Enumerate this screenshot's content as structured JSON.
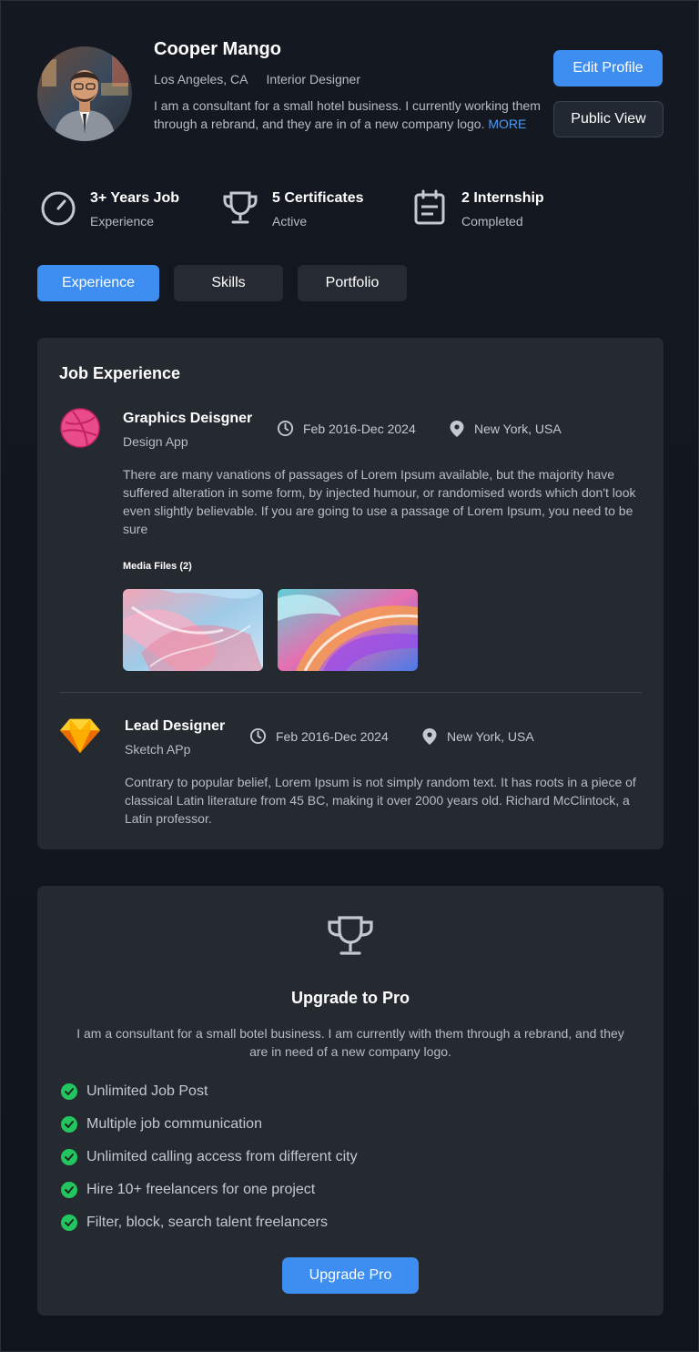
{
  "profile": {
    "name": "Cooper Mango",
    "location": "Los Angeles, CA",
    "role": "Interior Designer",
    "bio": "I am a consultant for a small hotel business. I currently working them through a rebrand, and they are in of a new company logo.",
    "more_label": "MORE",
    "edit_label": "Edit Profile",
    "public_label": "Public View"
  },
  "stats": [
    {
      "icon": "timer-icon",
      "title": "3+ Years Job",
      "subtitle": "Experience"
    },
    {
      "icon": "trophy-icon",
      "title": "5 Certificates",
      "subtitle": "Active"
    },
    {
      "icon": "calendar-note-icon",
      "title": "2 Internship",
      "subtitle": "Completed"
    }
  ],
  "tabs": [
    {
      "label": "Experience",
      "active": true
    },
    {
      "label": "Skills",
      "active": false
    },
    {
      "label": "Portfolio",
      "active": false
    }
  ],
  "experience": {
    "title": "Job Experience",
    "jobs": [
      {
        "logo": "dribbble-icon",
        "title": "Graphics Deisgner",
        "company": "Design App",
        "dates": "Feb 2016-Dec 2024",
        "location": "New York, USA",
        "description": "There are many vanations of passages of Lorem Ipsum available, but the majority have suffered alteration in some form, by injected humour, or randomised words which don't look even slightly believable. If you are going to use a passage of Lorem Ipsum, you need to be sure",
        "media_label": "Media Files (2)"
      },
      {
        "logo": "sketch-icon",
        "title": "Lead Designer",
        "company": "Sketch APp",
        "dates": "Feb 2016-Dec 2024",
        "location": "New York, USA",
        "description": "Contrary to popular belief, Lorem Ipsum is not simply random text. It has roots in a piece of classical Latin literature from 45 BC, making it over 2000 years old. Richard McClintock, a Latin professor."
      }
    ]
  },
  "pro": {
    "icon": "trophy-icon",
    "title": "Upgrade to Pro",
    "description": "I am a consultant for a small botel business. I am currently with them through a rebrand, and they are in need of a new company logo.",
    "features": [
      "Unlimited Job Post",
      "Multiple job communication",
      "Unlimited calling access from different city",
      "Hire 10+ freelancers for one project",
      "Filter, block, search talent freelancers"
    ],
    "button_label": "Upgrade Pro"
  },
  "colors": {
    "accent": "#3d8ef0",
    "background": "#121620",
    "card": "#252a31",
    "check": "#22c55e"
  }
}
